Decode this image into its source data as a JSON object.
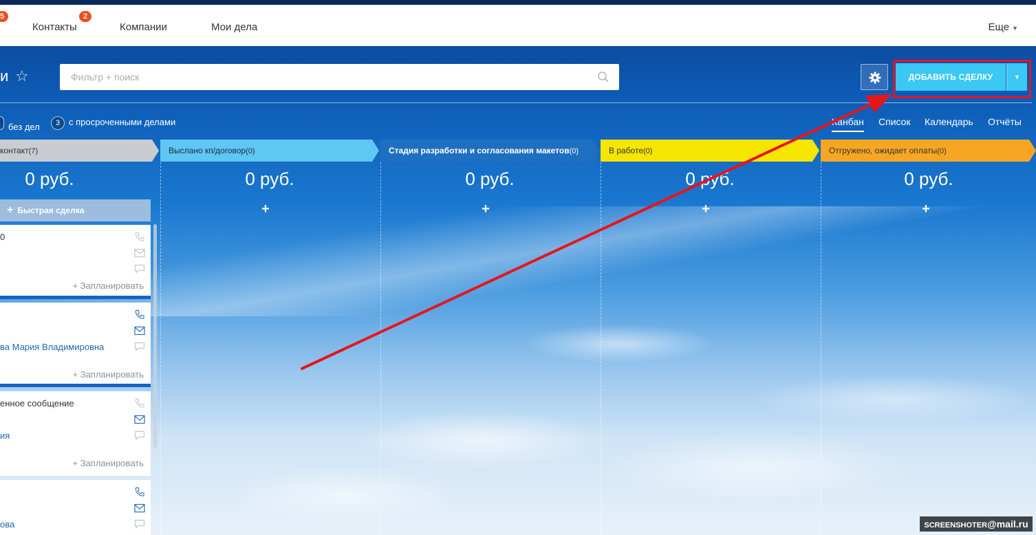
{
  "topnav": {
    "left_badge": "5",
    "items": [
      {
        "label": "Контакты",
        "badge": "2"
      },
      {
        "label": "Компании"
      },
      {
        "label": "Мои дела"
      }
    ],
    "more_label": "Еще"
  },
  "header": {
    "title_fragment": "и",
    "search_placeholder": "Фильтр + поиск",
    "add_deal_label": "ДОБАВИТЬ СДЕЛКУ"
  },
  "filters": {
    "no_tasks": {
      "label": "без дел"
    },
    "overdue": {
      "count": "3",
      "label": "с просроченными делами"
    }
  },
  "views": [
    {
      "label": "Канбан",
      "active": true
    },
    {
      "label": "Список"
    },
    {
      "label": "Календарь"
    },
    {
      "label": "Отчёты"
    }
  ],
  "stages": [
    {
      "name": "контакт",
      "count": "(7)",
      "sum": "0 руб.",
      "color": "#c9cdd1",
      "text_color": "#333333"
    },
    {
      "name": "Выслано кп/договор",
      "count": "(0)",
      "sum": "0 руб.",
      "color": "#5ec7f3",
      "text_color": "#1c2b36"
    },
    {
      "name": "Стадия разработки и согласования макетов",
      "count": "(0)",
      "sum": "0 руб.",
      "color": "#1f6fc0",
      "text_color": "#ffffff"
    },
    {
      "name": "В работе",
      "count": "(0)",
      "sum": "0 руб.",
      "color": "#f5e600",
      "text_color": "#333333"
    },
    {
      "name": "Отгружено, ожидает оплаты",
      "count": "(0)",
      "sum": "0 руб.",
      "color": "#f6a623",
      "text_color": "#333333"
    }
  ],
  "quick_deal_label": "Быстрая сделка",
  "plus_label": "+",
  "cards": [
    {
      "title": "0",
      "link": "",
      "plan": "+ Запланировать"
    },
    {
      "title": "",
      "link": "ва Мария Владимировна",
      "plan": "+ Запланировать"
    },
    {
      "title": "енное сообщение",
      "link": "ия",
      "plan": "+ Запланировать"
    },
    {
      "title": "",
      "link": "ова",
      "plan": ""
    }
  ],
  "watermark": {
    "prefix": "SCREENSHOTER",
    "suffix": "@mail.ru"
  },
  "colors": {
    "accent": "#3bc8f5",
    "highlight": "#e8141b",
    "badge": "#f24e1e"
  }
}
